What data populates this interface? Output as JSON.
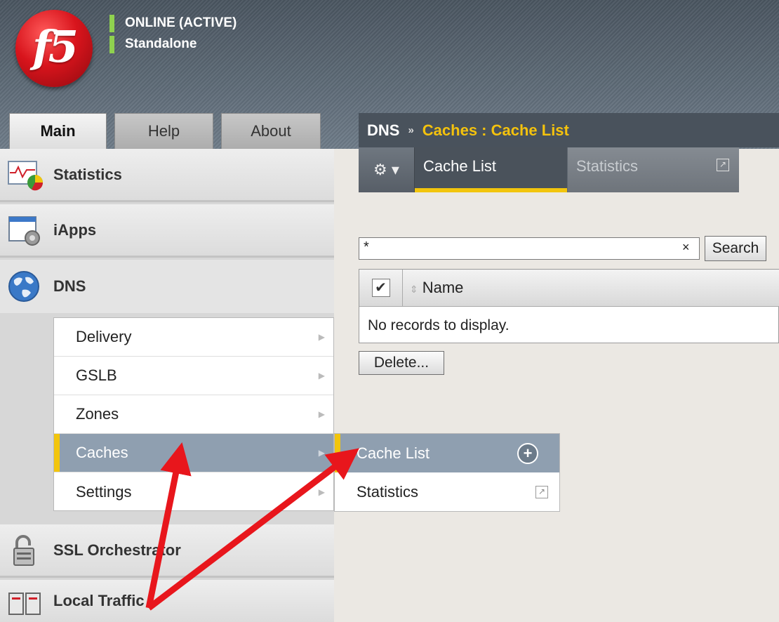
{
  "header": {
    "logo_text": "f5",
    "status_primary": "ONLINE (ACTIVE)",
    "status_secondary": "Standalone",
    "status_color": "#8fd14f"
  },
  "top_tabs": {
    "main": "Main",
    "help": "Help",
    "about": "About"
  },
  "nav": {
    "statistics": "Statistics",
    "iapps": "iApps",
    "dns": "DNS",
    "ssl": "SSL Orchestrator",
    "local_traffic": "Local Traffic",
    "dns_items": [
      "Delivery",
      "GSLB",
      "Zones",
      "Caches",
      "Settings"
    ],
    "active_item": "Caches"
  },
  "flyout": {
    "items": [
      "Cache List",
      "Statistics"
    ],
    "active": "Cache List"
  },
  "breadcrumb": {
    "root": "DNS",
    "separator": "»",
    "path": "Caches : Cache List"
  },
  "subtabs": {
    "gear": "⚙ ▾",
    "active": "Cache List",
    "inactive": "Statistics"
  },
  "search": {
    "value": "*",
    "clear": "×",
    "button": "Search"
  },
  "table": {
    "columns": [
      "Name"
    ],
    "empty_message": "No records to display."
  },
  "actions": {
    "delete": "Delete..."
  },
  "colors": {
    "accent_yellow": "#f2c50d",
    "nav_active": "#8f9fb0",
    "annotation_arrow": "#e8161c"
  }
}
